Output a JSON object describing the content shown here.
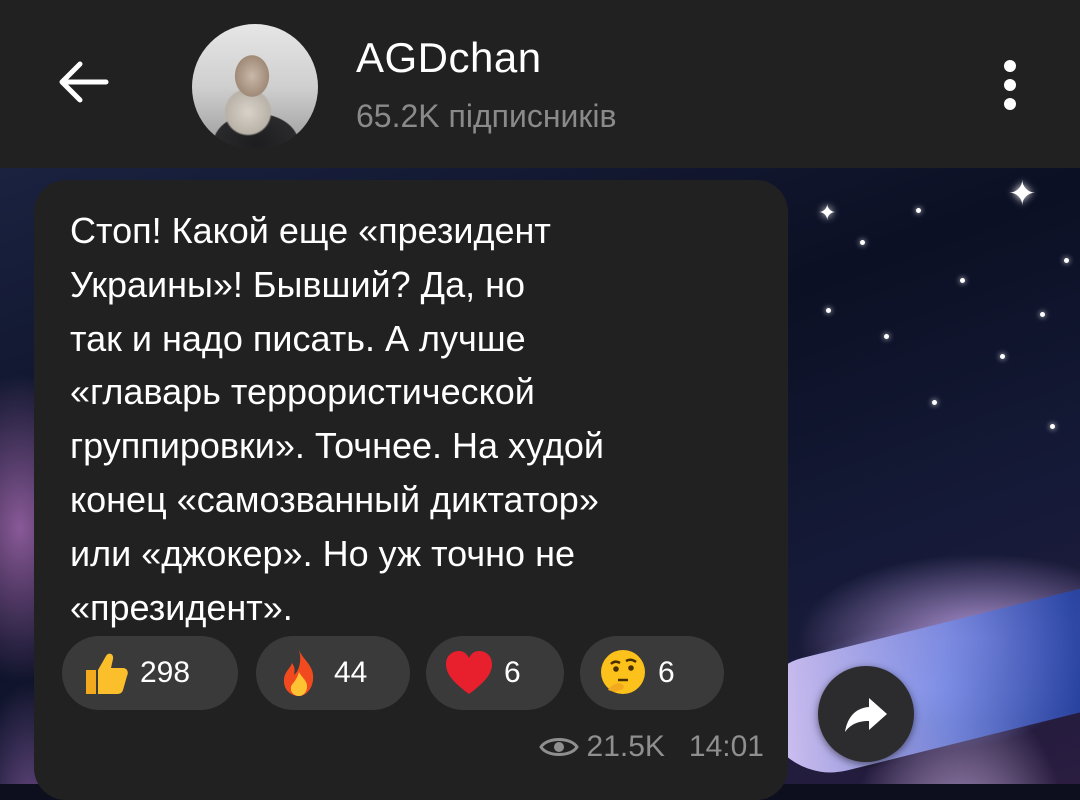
{
  "header": {
    "channel_name": "AGDchan",
    "subscribers": "65.2K підписників",
    "back_icon": "arrow-left-icon",
    "menu_icon": "more-vertical-icon"
  },
  "message": {
    "text": "Стоп! Какой еще «президент\nУкраины»! Бывший? Да, но\nтак и надо писать. А лучше\n«главарь террористической\nгруппировки». Точнее. На худой\nконец «самозванный диктатор»\nили «джокер». Но уж точно не\n«президент».",
    "reactions": [
      {
        "emoji": "thumbs-up-icon",
        "count": "298"
      },
      {
        "emoji": "fire-icon",
        "count": "44"
      },
      {
        "emoji": "heart-icon",
        "count": "6"
      },
      {
        "emoji": "thinking-face-icon",
        "count": "6"
      }
    ],
    "views": "21.5K",
    "time": "14:01"
  },
  "colors": {
    "header_bg": "#212121",
    "bubble_bg": "#212121",
    "reaction_bg": "#3a3a3a",
    "meta_text": "#8f8f8f"
  }
}
